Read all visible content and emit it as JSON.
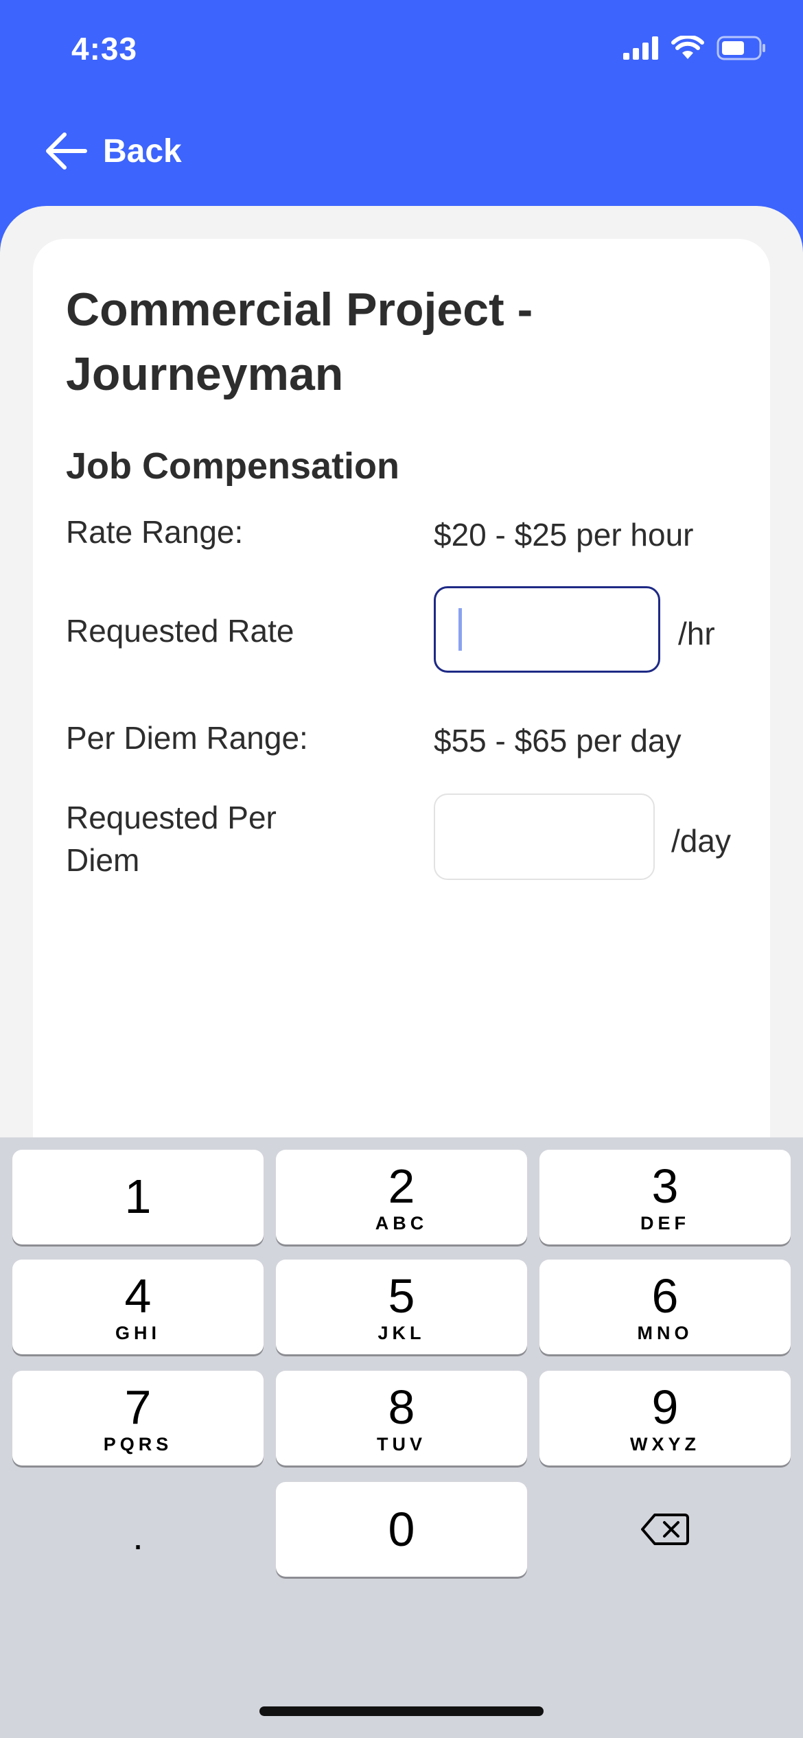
{
  "status_bar": {
    "time": "4:33"
  },
  "nav": {
    "back_label": "Back"
  },
  "job": {
    "title": "Commercial Project - Journeyman",
    "section_title": "Job Compensation",
    "rate_range_label": "Rate Range:",
    "rate_range_value": "$20 - $25 per hour",
    "requested_rate_label": "Requested Rate",
    "requested_rate_value": "",
    "rate_unit": "/hr",
    "per_diem_range_label": "Per Diem Range:",
    "per_diem_range_value": "$55 - $65 per day",
    "requested_per_diem_label": "Requested Per Diem",
    "requested_per_diem_value": "",
    "per_diem_unit": "/day"
  },
  "keyboard": {
    "keys": [
      {
        "digit": "1",
        "letters": ""
      },
      {
        "digit": "2",
        "letters": "ABC"
      },
      {
        "digit": "3",
        "letters": "DEF"
      },
      {
        "digit": "4",
        "letters": "GHI"
      },
      {
        "digit": "5",
        "letters": "JKL"
      },
      {
        "digit": "6",
        "letters": "MNO"
      },
      {
        "digit": "7",
        "letters": "PQRS"
      },
      {
        "digit": "8",
        "letters": "TUV"
      },
      {
        "digit": "9",
        "letters": "WXYZ"
      },
      {
        "digit": "0",
        "letters": ""
      }
    ],
    "decimal": "."
  },
  "colors": {
    "header_bg": "#3d64fc",
    "focus_border": "#1e2a85",
    "keyboard_bg": "#d3d5dc"
  }
}
